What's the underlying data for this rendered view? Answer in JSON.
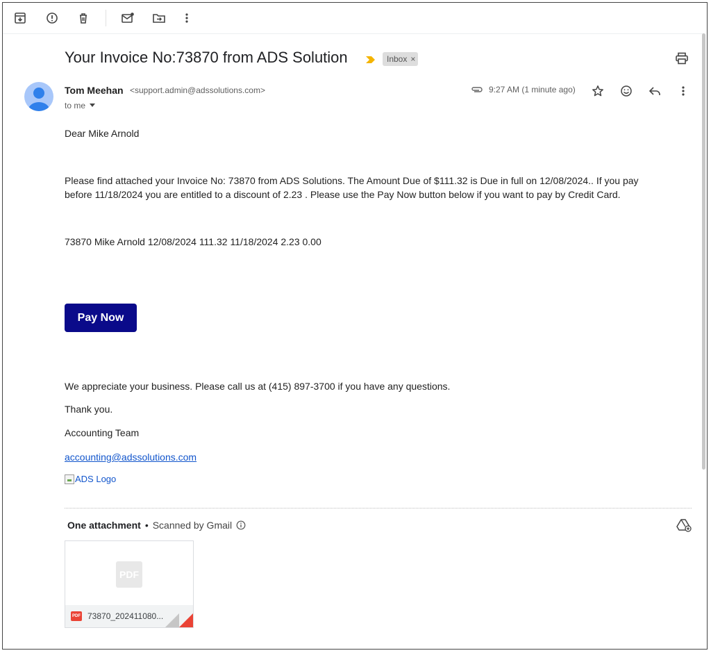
{
  "toolbar": {
    "icons": [
      "archive-icon",
      "report-spam-icon",
      "delete-icon",
      "mark-unread-icon",
      "move-to-icon",
      "more-vert-icon"
    ]
  },
  "email": {
    "subject": "Your Invoice No:73870 from ADS Solution",
    "label": "Inbox",
    "label_remove": "×",
    "sender_name": "Tom Meehan",
    "sender_email": "<support.admin@adssolutions.com>",
    "recipient": "to me",
    "timestamp": "9:27 AM (1 minute ago)"
  },
  "body": {
    "greeting": "Dear Mike Arnold",
    "paragraph": "Please find attached your Invoice No: 73870  from ADS Solutions. The Amount Due of $111.32 is Due in full on 12/08/2024.. If you pay before 11/18/2024 you are entitled to a discount of  2.23 . Please use the Pay Now button below if you want to pay by Credit Card.",
    "summary_line": "73870 Mike Arnold 12/08/2024 111.32 11/18/2024 2.23 0.00",
    "pay_button": "Pay Now",
    "appreciation": "We appreciate your business. Please call us at (415) 897-3700 if you have any questions.",
    "thanks": "Thank you.",
    "signature": "Accounting Team",
    "email_link": "accounting@adssolutions.com",
    "logo_alt": "ADS Logo"
  },
  "attachments": {
    "count_label": "One attachment",
    "separator": "•",
    "scan_label": "Scanned by Gmail",
    "file": {
      "preview_badge": "PDF",
      "type_badge": "PDF",
      "name": "73870_202411080..."
    }
  },
  "colors": {
    "pay_button": "#0a0a8a",
    "link": "#1155cc",
    "pdf_red": "#ea4335",
    "avatar": "#a8c7fa",
    "importance_marker": "#f4b400"
  }
}
